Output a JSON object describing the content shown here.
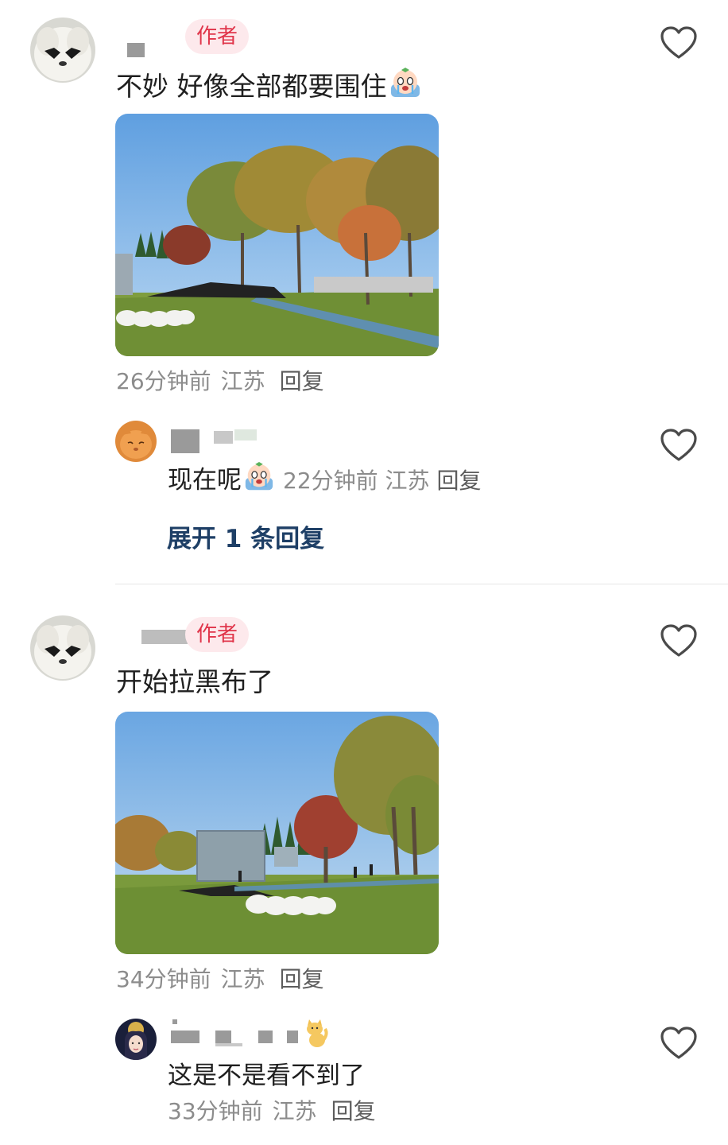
{
  "comments": [
    {
      "author_badge": "作者",
      "text": "不妙 好像全部都要围住",
      "meta_time": "26分钟前",
      "meta_location": "江苏",
      "meta_reply": "回复",
      "reply": {
        "text": "现在呢",
        "time": "22分钟前",
        "location": "江苏",
        "reply_label": "回复"
      },
      "expand_label": "展开 1 条回复"
    },
    {
      "author_badge": "作者",
      "text": "开始拉黑布了",
      "meta_time": "34分钟前",
      "meta_location": "江苏",
      "meta_reply": "回复",
      "reply": {
        "text": "这是不是看不到了",
        "time": "33分钟前",
        "location": "江苏",
        "reply_label": "回复"
      }
    }
  ],
  "icons": {
    "like": "heart-outline-icon",
    "crying_emoji": "crying-emoji-icon",
    "cat_emoji": "cat-emoji-icon"
  },
  "colors": {
    "author_badge_bg": "#fde9ec",
    "author_badge_text": "#e0354a",
    "expand_link": "#1e3f66",
    "meta_gray": "#8c8c8c"
  }
}
